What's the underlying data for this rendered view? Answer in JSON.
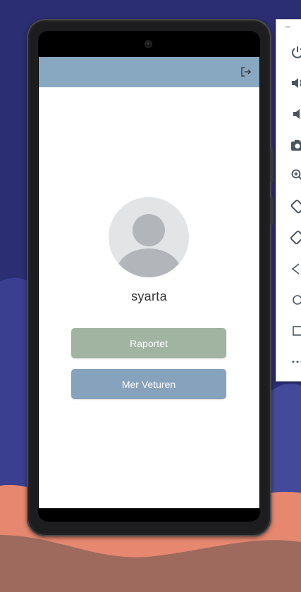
{
  "app": {
    "username": "syarta",
    "buttons": {
      "reports_label": "Raportet",
      "trips_label": "Mer Veturen"
    },
    "header": {
      "logout_icon": "logout-icon"
    }
  },
  "colors": {
    "appbar": "#88a7c1",
    "reports_button": "#a1b3a1",
    "trips_button": "#86a2bd",
    "avatar_bg": "#e3e4e6",
    "avatar_figure": "#b2b6ba"
  },
  "emulator_toolbar": {
    "window_control": "–",
    "icons": [
      "power-icon",
      "volume-up-icon",
      "volume-down-icon",
      "camera-icon",
      "zoom-icon",
      "rotate-left-icon",
      "rotate-right-icon",
      "back-icon",
      "home-icon",
      "overview-icon",
      "more-icon"
    ]
  }
}
